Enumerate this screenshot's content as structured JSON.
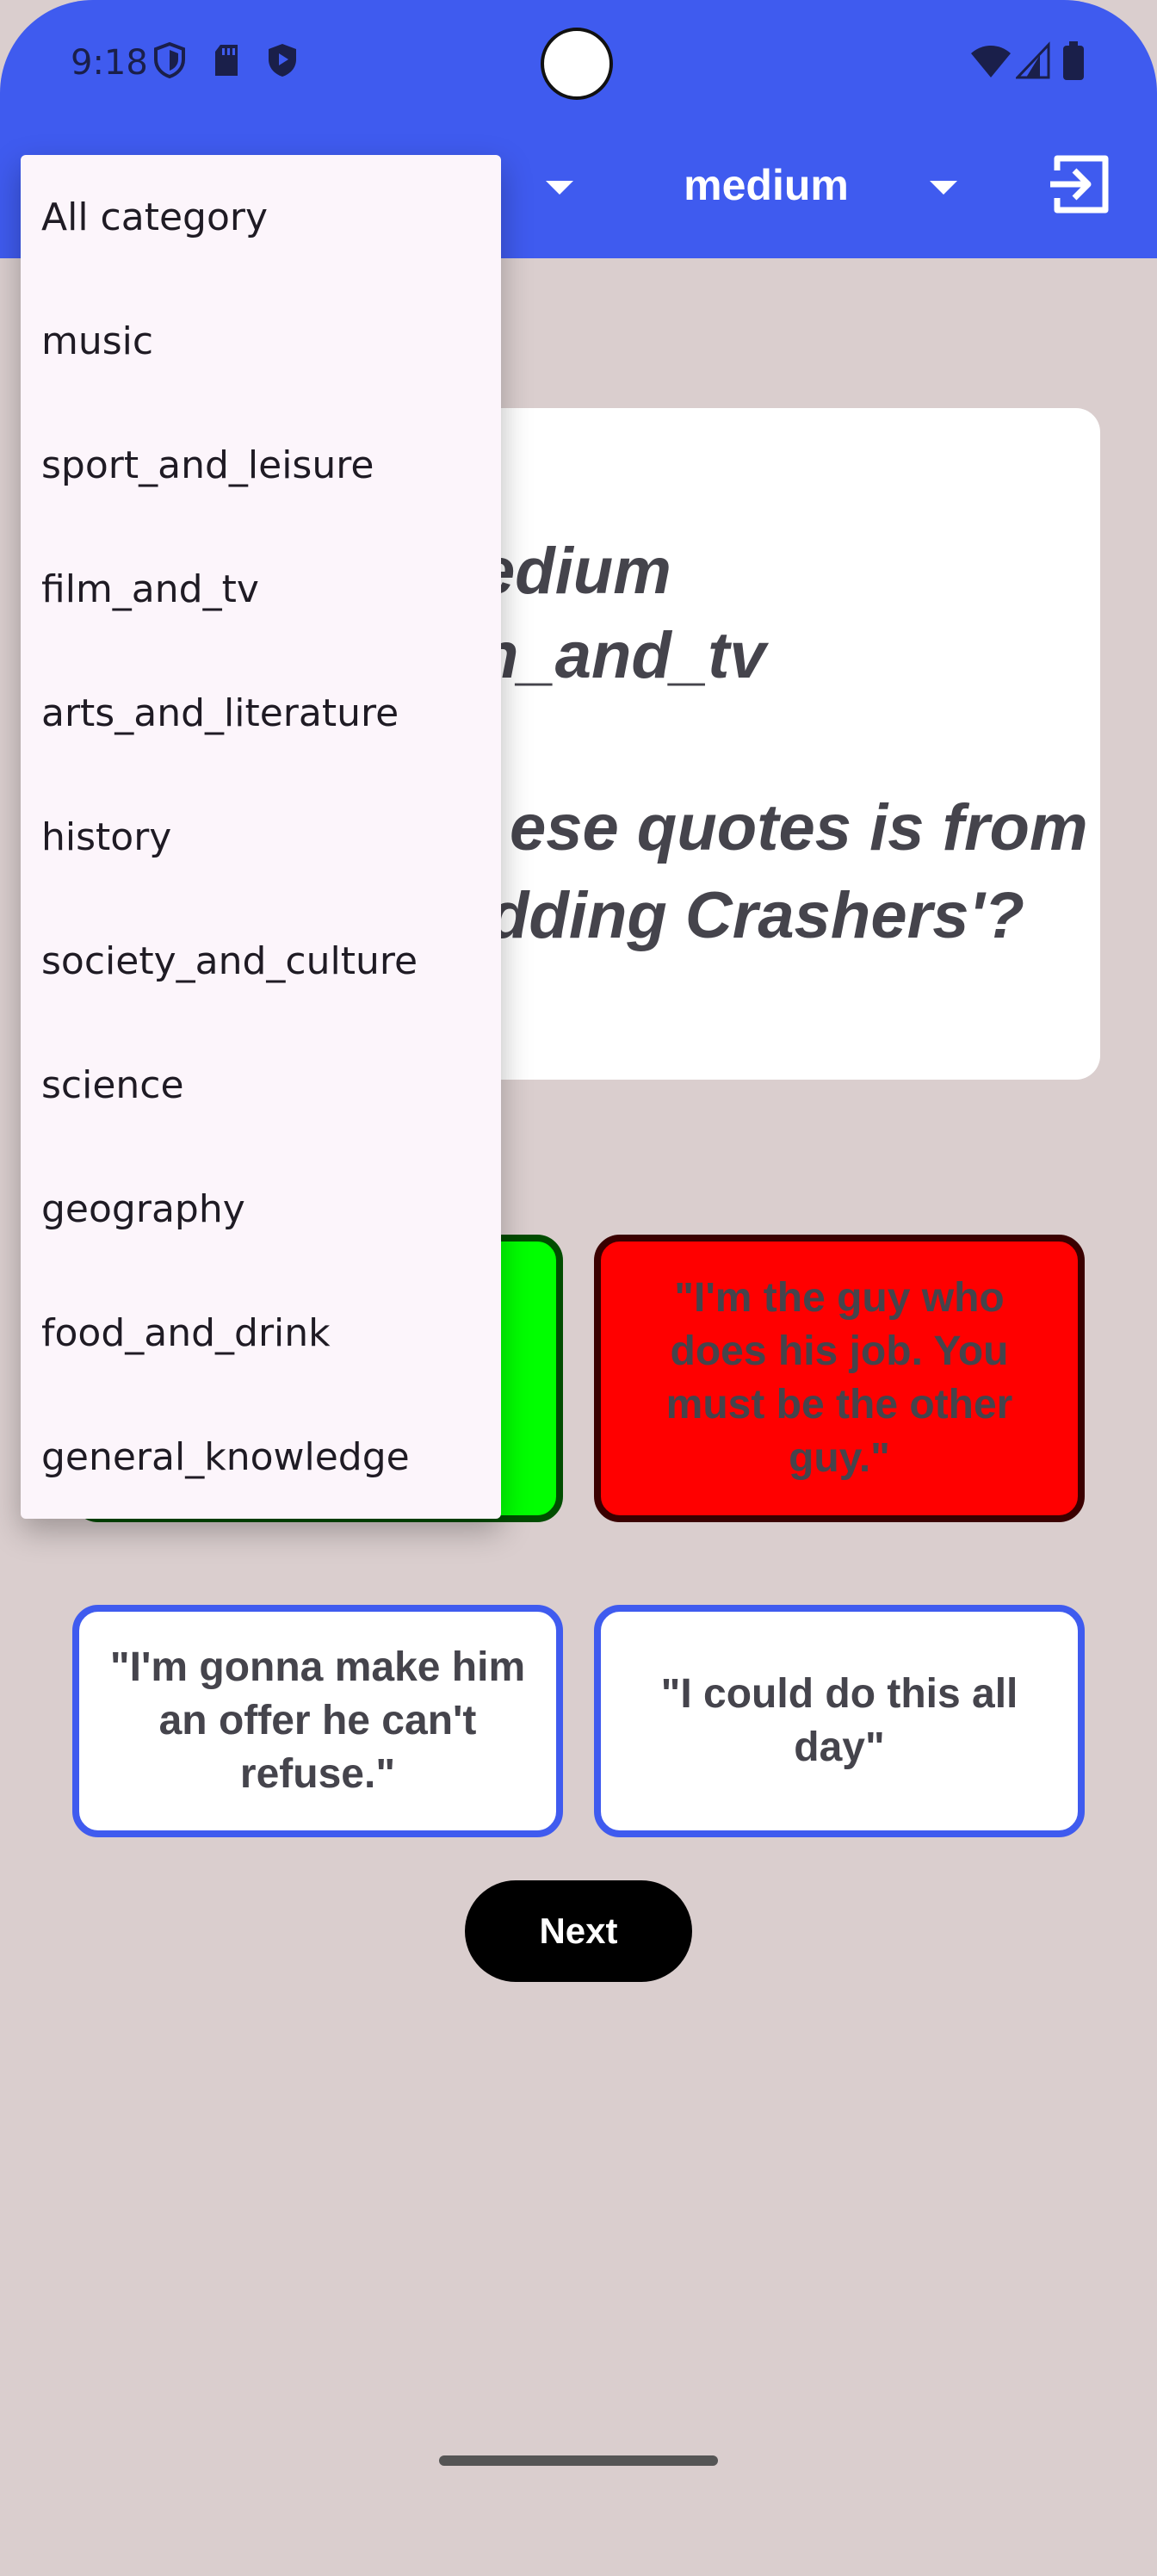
{
  "status_bar": {
    "time": "9:18",
    "left_icons": [
      "shield-icon",
      "sd-card-icon",
      "play-protect-icon"
    ],
    "right_icons": [
      "wifi-icon",
      "cell-signal-icon",
      "battery-icon"
    ]
  },
  "app_bar": {
    "difficulty_selected": "medium",
    "exit_icon": "exit-icon",
    "color": "#3f5bef"
  },
  "question": {
    "line1": "edium",
    "line2": "n_and_tv",
    "line3": "ese quotes is from",
    "line4": "dding Crashers'?"
  },
  "answers": [
    {
      "text": "",
      "state": "correct",
      "color": "#00ff00"
    },
    {
      "text": "\"I'm the guy who does his job. You must be the other guy.\"",
      "state": "wrong",
      "color": "#ff0000"
    },
    {
      "text": "\"I'm gonna make him an offer he can't refuse.\"",
      "state": "normal"
    },
    {
      "text": "\"I could do this all day\"",
      "state": "normal"
    }
  ],
  "next_label": "Next",
  "category_menu": {
    "items": [
      "All category",
      "music",
      "sport_and_leisure",
      "film_and_tv",
      "arts_and_literature",
      "history",
      "society_and_culture",
      "science",
      "geography",
      "food_and_drink",
      "general_knowledge"
    ]
  }
}
